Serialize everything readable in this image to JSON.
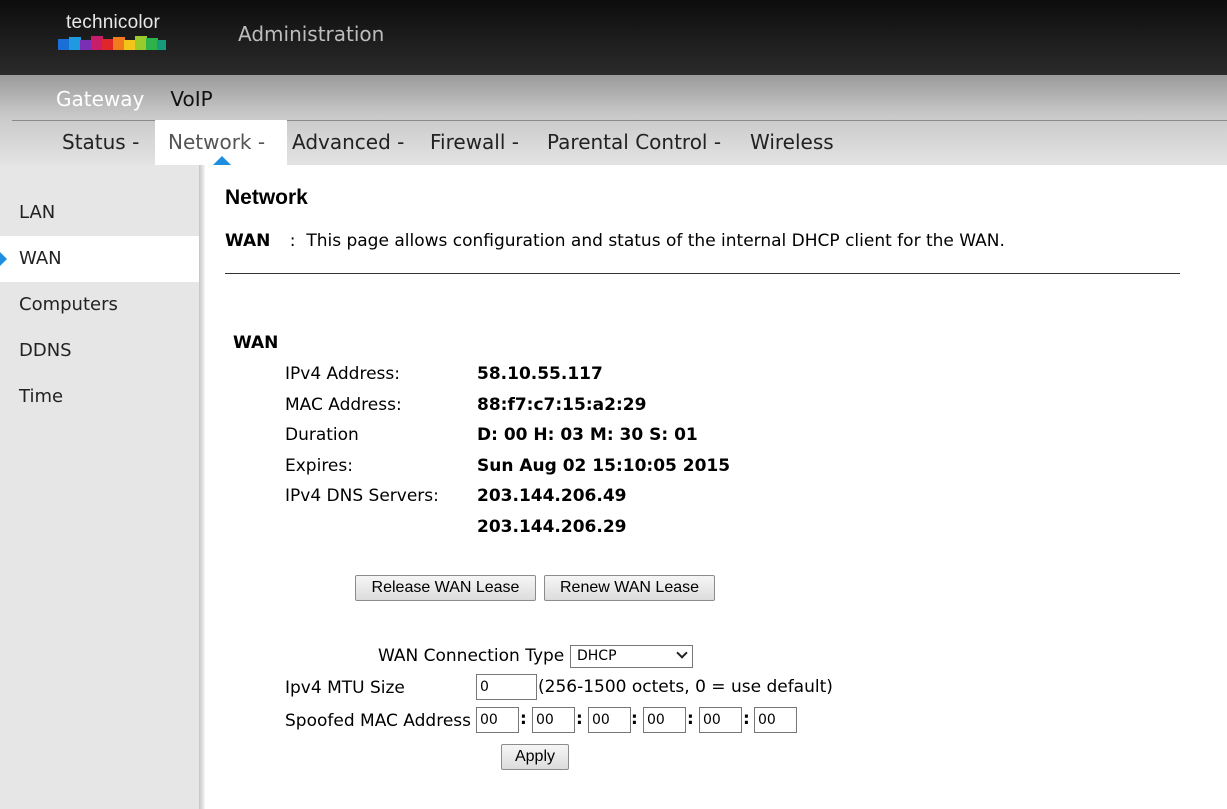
{
  "header": {
    "brand": "technicolor",
    "title": "Administration"
  },
  "nav": {
    "primary": [
      "Gateway",
      "VoIP"
    ],
    "secondary": [
      "Status -",
      "Network -",
      "Advanced -",
      "Firewall -",
      "Parental Control -",
      "Wireless"
    ]
  },
  "sidebar": {
    "items": [
      "LAN",
      "WAN",
      "Computers",
      "DDNS",
      "Time"
    ],
    "selected": "WAN"
  },
  "main": {
    "heading": "Network",
    "desc_key": "WAN",
    "desc_sep": ":",
    "desc_text": "This page allows configuration and status of the internal DHCP client for the WAN.",
    "section": "WAN",
    "fields": [
      {
        "label": "IPv4 Address:",
        "value": "58.10.55.117"
      },
      {
        "label": "MAC Address:",
        "value": "88:f7:c7:15:a2:29"
      },
      {
        "label": "Duration",
        "value": "D: 00 H: 03 M: 30 S: 01"
      },
      {
        "label": "Expires:",
        "value": "Sun Aug 02 15:10:05 2015"
      },
      {
        "label": "IPv4 DNS Servers:",
        "value": "203.144.206.49"
      },
      {
        "label": "",
        "value": "203.144.206.29"
      }
    ],
    "release_button": "Release WAN Lease",
    "renew_button": "Renew WAN Lease",
    "conn_type_label": "WAN Connection Type",
    "conn_type_value": "DHCP",
    "mtu_label": "Ipv4 MTU Size",
    "mtu_value": "0",
    "mtu_hint": "(256-1500 octets, 0 = use default)",
    "mac_label": "Spoofed MAC Address",
    "mac_parts": [
      "00",
      "00",
      "00",
      "00",
      "00",
      "00"
    ],
    "mac_sep": ":",
    "apply_button": "Apply"
  }
}
